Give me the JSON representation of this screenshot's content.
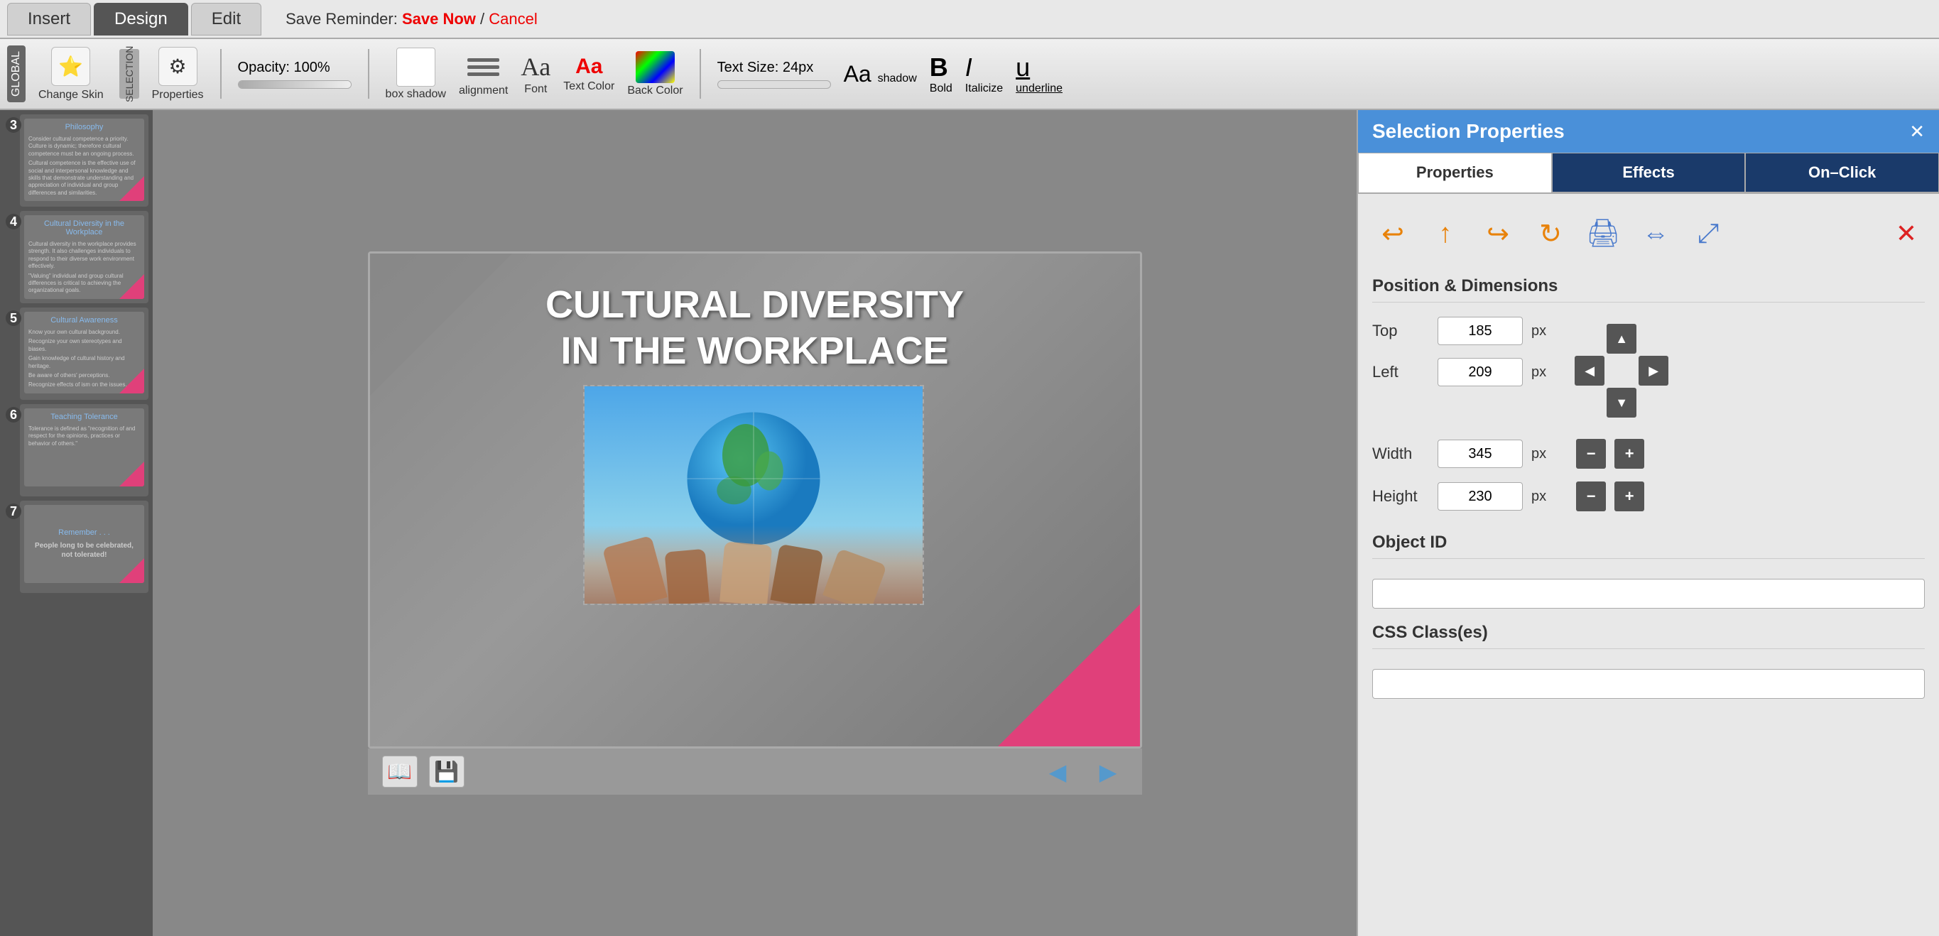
{
  "nav": {
    "tabs": [
      {
        "id": "insert",
        "label": "Insert",
        "active": false
      },
      {
        "id": "design",
        "label": "Design",
        "active": true
      },
      {
        "id": "edit",
        "label": "Edit",
        "active": false
      }
    ],
    "save_reminder": "Save Reminder:",
    "save_now": "Save Now",
    "cancel": "Cancel"
  },
  "toolbar": {
    "global_label": "GLOBAL",
    "selection_label": "SELECTION",
    "change_skin_label": "Change Skin",
    "properties_label": "Properties",
    "opacity_label": "Opacity: 100%",
    "box_shadow_label": "box shadow",
    "alignment_label": "alignment",
    "font_label": "Font",
    "text_color_label": "Text Color",
    "back_color_label": "Back Color",
    "text_size_label": "Text Size: 24px",
    "shadow_label": "shadow",
    "bold_label": "Bold",
    "italic_label": "Italicize",
    "underline_label": "underline"
  },
  "slides": [
    {
      "num": "3",
      "title": "Philosophy",
      "texts": [
        "Consider cultural competence a priority. Culture is dynamic; therefore cultural competence must be an ongoing process.",
        "Cultural competence is the effective use of social and interpersonal knowledge and skills that demonstrate understanding and appreciation of individual and group differences and similarities."
      ]
    },
    {
      "num": "4",
      "title": "Cultural Diversity in the Workplace",
      "texts": [
        "Cultural diversity in the workplace provides strength. It also challenges individuals to respond to their diverse work environment effectively.",
        "\"Valuing\" individual and group cultural differences is critical to achieving the organizational goals."
      ]
    },
    {
      "num": "5",
      "title": "Cultural Awareness",
      "texts": [
        "Know your own cultural background.",
        "Recognize your own stereotypes and biases.",
        "Gain knowledge of cultural history and heritage.",
        "Be aware of others' perceptions.",
        "Recognize effects of ism on the issues."
      ]
    },
    {
      "num": "6",
      "title": "Teaching Tolerance",
      "texts": [
        "Tolerance is defined as \"recognition of and respect for the opinions, practices or behavior of others.\""
      ]
    },
    {
      "num": "7",
      "title": "Remember . . .",
      "texts": [
        "People long to be celebrated, not tolerated!"
      ]
    }
  ],
  "canvas": {
    "slide_title_line1": "CULTURAL DIVERSITY",
    "slide_title_line2": "IN THE WORKPLACE",
    "canvas_toolbar": {
      "book_icon": "📖",
      "save_icon": "💾",
      "left_arrow": "◀",
      "right_arrow": "▶"
    }
  },
  "right_panel": {
    "header_title": "Selection Properties",
    "close_btn": "✕",
    "tabs": [
      {
        "id": "properties",
        "label": "Properties",
        "active": true
      },
      {
        "id": "effects",
        "label": "Effects",
        "active": false
      },
      {
        "id": "on-click",
        "label": "On–Click",
        "active": false
      }
    ],
    "action_icons": [
      {
        "id": "rotate-left",
        "symbol": "↩",
        "color": "orange"
      },
      {
        "id": "rotate-up",
        "symbol": "↑",
        "color": "orange"
      },
      {
        "id": "rotate-back",
        "symbol": "↪",
        "color": "orange"
      },
      {
        "id": "rotate-forward",
        "symbol": "↻",
        "color": "orange"
      },
      {
        "id": "print",
        "symbol": "🖨",
        "color": "blue"
      },
      {
        "id": "flip",
        "symbol": "⇔",
        "color": "blue"
      },
      {
        "id": "expand",
        "symbol": "⤢",
        "color": "blue"
      }
    ],
    "position_dimensions": {
      "section_title": "Position & Dimensions",
      "top_label": "Top",
      "top_value": "185",
      "top_unit": "px",
      "left_label": "Left",
      "left_value": "209",
      "left_unit": "px",
      "width_label": "Width",
      "width_value": "345",
      "width_unit": "px",
      "height_label": "Height",
      "height_value": "230",
      "height_unit": "px"
    },
    "object_id": {
      "label": "Object ID",
      "value": ""
    },
    "css_classes": {
      "label": "CSS Class(es)",
      "value": ""
    }
  }
}
